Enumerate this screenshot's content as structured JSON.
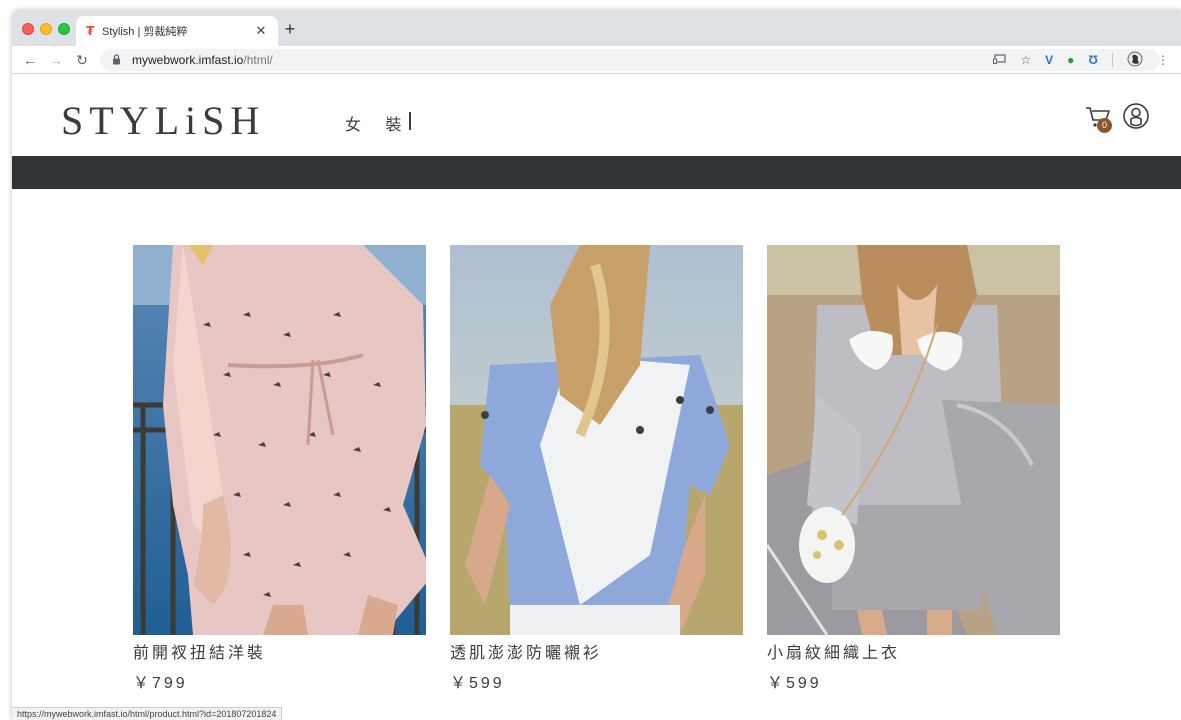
{
  "browser": {
    "tab_title": "Stylish | 剪裁純粹",
    "tab_favicon": "₮",
    "url_host": "mywebwork.imfast.io",
    "url_path": "/html/",
    "status_url": "https://mywebwork.imfast.io/html/product.html?id=201807201824",
    "icons": {
      "back": "back-arrow-icon",
      "forward": "forward-arrow-icon",
      "reload": "reload-icon",
      "lock": "lock-icon",
      "cast": "cast-icon",
      "star": "bookmark-star-icon",
      "ext1": "v-extension-icon",
      "ext2": "evernote-icon",
      "ext3": "u-extension-icon",
      "profile": "profile-avatar-icon",
      "menu": "kebab-menu-icon"
    }
  },
  "site": {
    "logo": "STYLiSH",
    "nav": {
      "women": "女 裝"
    },
    "cart_count": "0",
    "colors": {
      "brand_text": "#3f3a3a",
      "dark_bar": "#313538",
      "badge": "#8b572a"
    }
  },
  "products": [
    {
      "name": "前開衩扭結洋裝",
      "price": "￥799",
      "image": "pink-bird-print-wrap-dress-photo"
    },
    {
      "name": "透肌澎澎防曬襯衫",
      "price": "￥599",
      "image": "blue-white-shirt-back-view-photo"
    },
    {
      "name": "小扇紋細織上衣",
      "price": "￥599",
      "image": "grey-shell-pattern-top-photo"
    }
  ]
}
